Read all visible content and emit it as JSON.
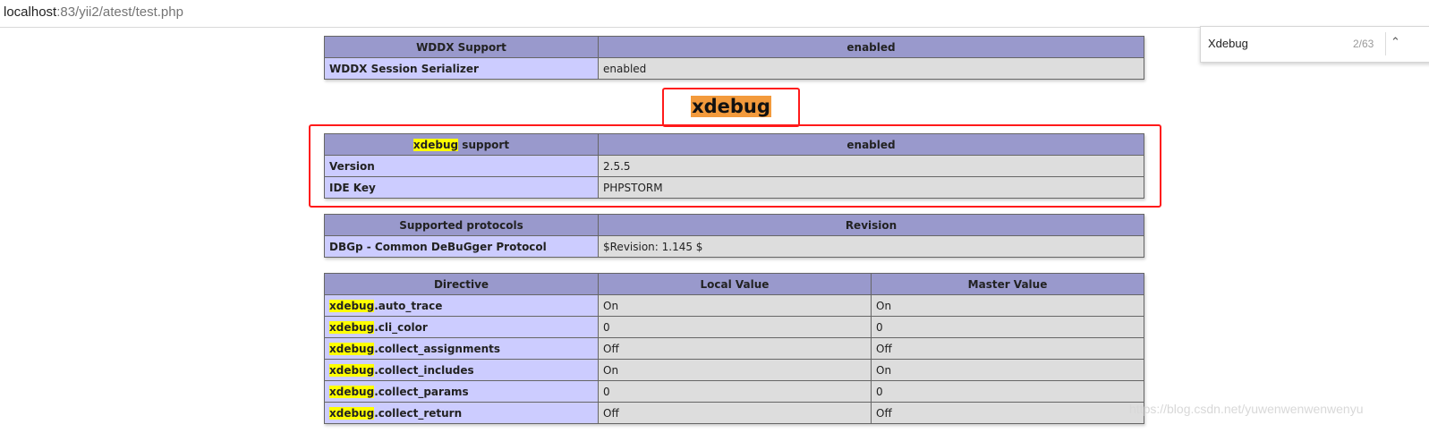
{
  "browser": {
    "url_host": "localhost",
    "url_rest": ":83/yii2/atest/test.php"
  },
  "find_bar": {
    "query": "Xdebug",
    "count": "2/63",
    "up_icon": "chevron-up-icon"
  },
  "wddx": {
    "header": [
      "WDDX Support",
      "enabled"
    ],
    "rows": [
      [
        "WDDX Session Serializer",
        "enabled"
      ]
    ]
  },
  "xdebug_title": "xdebug",
  "xdebug_support": {
    "header_highlight": "xdebug",
    "header_rest": " support",
    "header_value": "enabled",
    "rows": [
      [
        "Version",
        "2.5.5"
      ],
      [
        "IDE Key",
        "PHPSTORM"
      ]
    ]
  },
  "protocols": {
    "header": [
      "Supported protocols",
      "Revision"
    ],
    "rows": [
      [
        "DBGp - Common DeBuGger Protocol",
        "$Revision: 1.145 $"
      ]
    ]
  },
  "directives": {
    "header": [
      "Directive",
      "Local Value",
      "Master Value"
    ],
    "prefix": "xdebug",
    "rows": [
      [
        ".auto_trace",
        "On",
        "On"
      ],
      [
        ".cli_color",
        "0",
        "0"
      ],
      [
        ".collect_assignments",
        "Off",
        "Off"
      ],
      [
        ".collect_includes",
        "On",
        "On"
      ],
      [
        ".collect_params",
        "0",
        "0"
      ],
      [
        ".collect_return",
        "Off",
        "Off"
      ]
    ]
  },
  "watermark": "https://blog.csdn.net/yuwenwenwenwenyu",
  "colors": {
    "header_bg": "#9999cc",
    "key_bg": "#ccccff",
    "value_bg": "#dddddd",
    "highlight": "#ffff00",
    "active_match": "#f39a3c",
    "annotation": "#ff1a1a"
  }
}
